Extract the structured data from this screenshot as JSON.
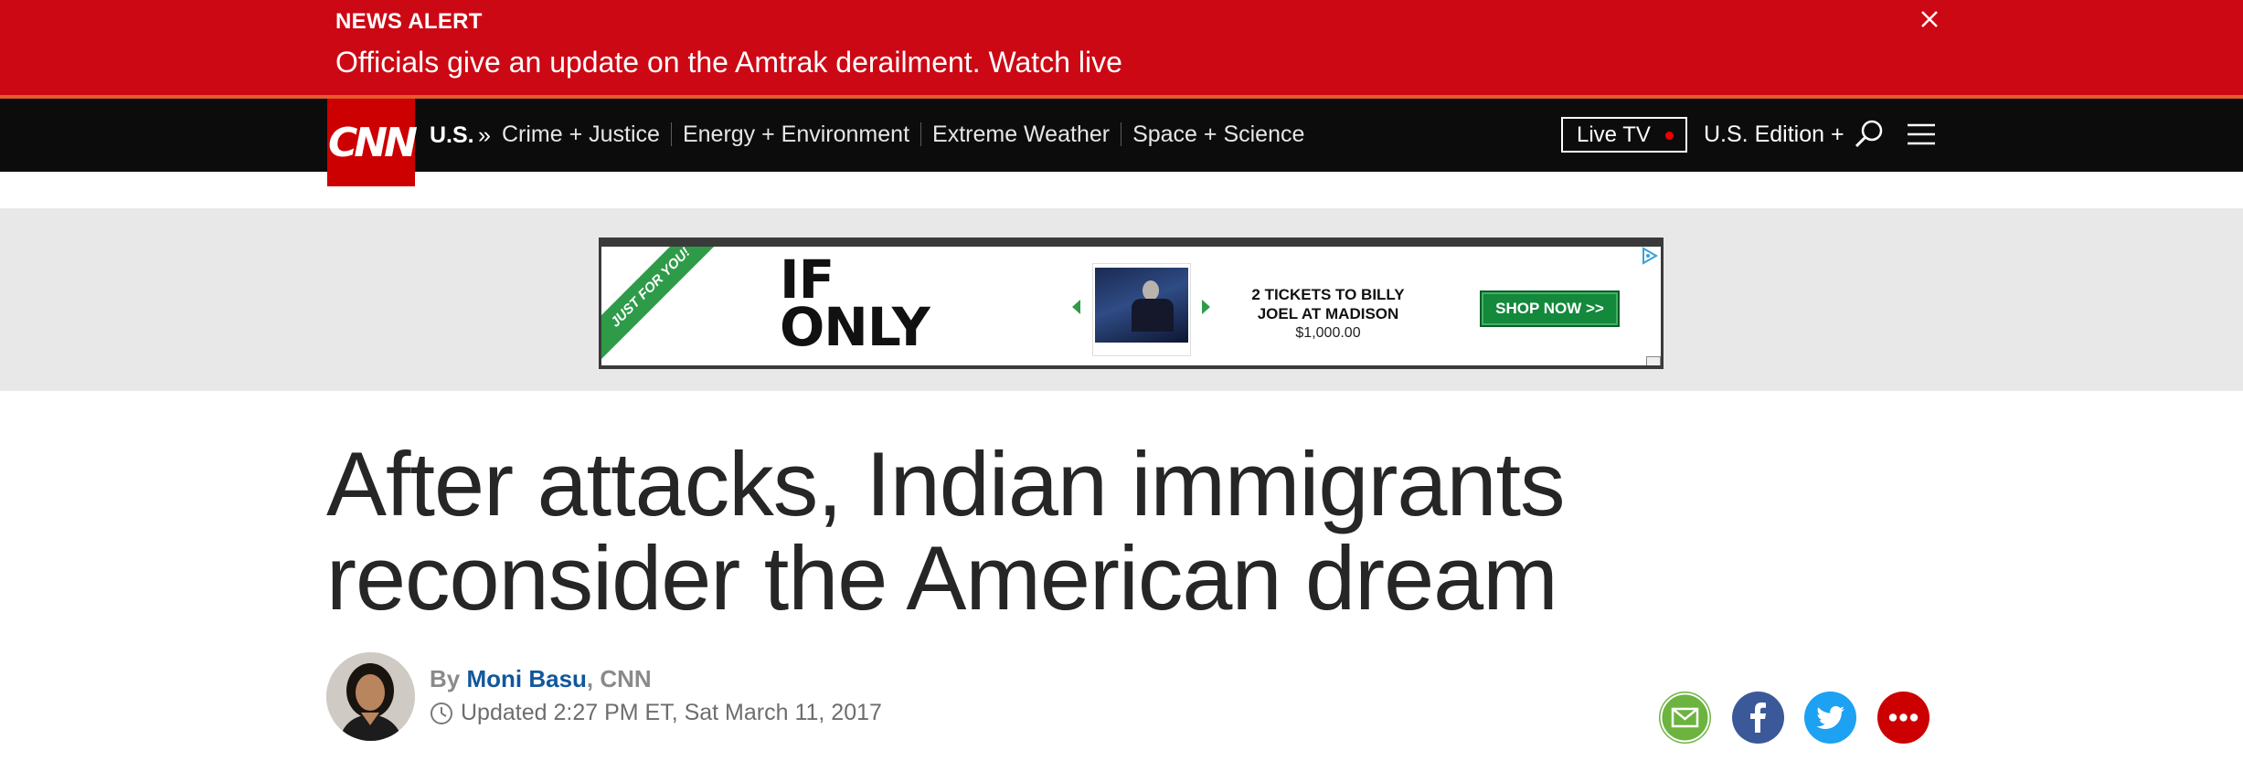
{
  "alert": {
    "kicker": "NEWS ALERT",
    "headline": "Officials give an update on the Amtrak derailment. Watch live"
  },
  "nav": {
    "logo": "CNN",
    "section": "U.S.",
    "separator": "»",
    "links": [
      "Crime + Justice",
      "Energy + Environment",
      "Extreme Weather",
      "Space + Science"
    ],
    "live_tv": "Live TV",
    "edition": "U.S. Edition +"
  },
  "ad": {
    "ribbon": "JUST FOR YOU!",
    "brand_line1": "IF",
    "brand_line2": "ONLY",
    "offer_line1": "2 TICKETS TO BILLY",
    "offer_line2": "JOEL AT MADISON",
    "price": "$1,000.00",
    "cta": "SHOP NOW >>"
  },
  "article": {
    "headline": "After attacks, Indian immigrants reconsider the American dream",
    "by_label": "By ",
    "author": "Moni Basu",
    "outlet": ", CNN",
    "updated": "Updated 2:27 PM ET, Sat March 11, 2017"
  },
  "colors": {
    "alert_red": "#cc0814",
    "nav_black": "#0c0c0c",
    "cnn_red": "#cc0000",
    "author_blue": "#11579b",
    "email_green": "#6cb33f",
    "facebook_blue": "#3b5998",
    "twitter_blue": "#1da1f2"
  },
  "share": {
    "icons": [
      "email-icon",
      "facebook-icon",
      "twitter-icon",
      "more-icon"
    ]
  }
}
